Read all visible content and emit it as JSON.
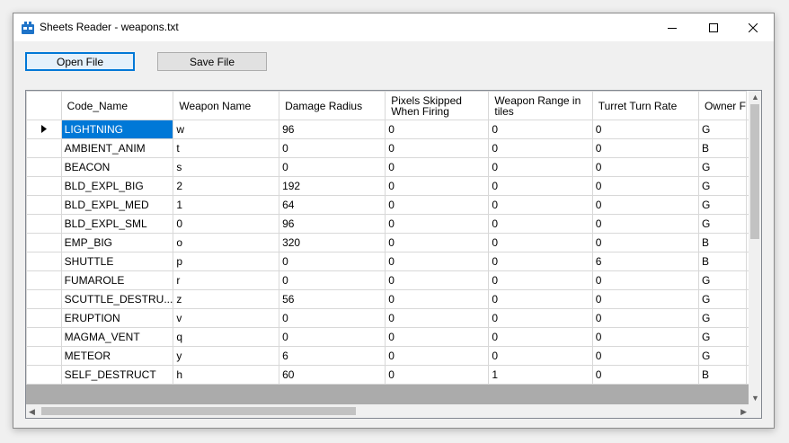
{
  "window": {
    "title": "Sheets Reader - weapons.txt"
  },
  "toolbar": {
    "open_label": "Open File",
    "save_label": "Save File"
  },
  "grid": {
    "columns": [
      "Code_Name",
      "Weapon Name",
      "Damage Radius",
      "Pixels Skipped When Firing",
      "Weapon Range in tiles",
      "Turret Turn Rate",
      "Owner F"
    ],
    "rows": [
      [
        "LIGHTNING",
        "w",
        "96",
        "0",
        "0",
        "0",
        "G"
      ],
      [
        "AMBIENT_ANIM",
        "t",
        "0",
        "0",
        "0",
        "0",
        "B"
      ],
      [
        "BEACON",
        "s",
        "0",
        "0",
        "0",
        "0",
        "G"
      ],
      [
        "BLD_EXPL_BIG",
        "2",
        "192",
        "0",
        "0",
        "0",
        "G"
      ],
      [
        "BLD_EXPL_MED",
        "1",
        "64",
        "0",
        "0",
        "0",
        "G"
      ],
      [
        "BLD_EXPL_SML",
        "0",
        "96",
        "0",
        "0",
        "0",
        "G"
      ],
      [
        "EMP_BIG",
        "o",
        "320",
        "0",
        "0",
        "0",
        "B"
      ],
      [
        "SHUTTLE",
        "p",
        "0",
        "0",
        "0",
        "6",
        "B"
      ],
      [
        "FUMAROLE",
        "r",
        "0",
        "0",
        "0",
        "0",
        "G"
      ],
      [
        "SCUTTLE_DESTRU...",
        "z",
        "56",
        "0",
        "0",
        "0",
        "G"
      ],
      [
        "ERUPTION",
        "v",
        "0",
        "0",
        "0",
        "0",
        "G"
      ],
      [
        "MAGMA_VENT",
        "q",
        "0",
        "0",
        "0",
        "0",
        "G"
      ],
      [
        "METEOR",
        "y",
        "6",
        "0",
        "0",
        "0",
        "G"
      ],
      [
        "SELF_DESTRUCT",
        "h",
        "60",
        "0",
        "1",
        "0",
        "B"
      ]
    ],
    "selection_color": "#0078d7"
  }
}
